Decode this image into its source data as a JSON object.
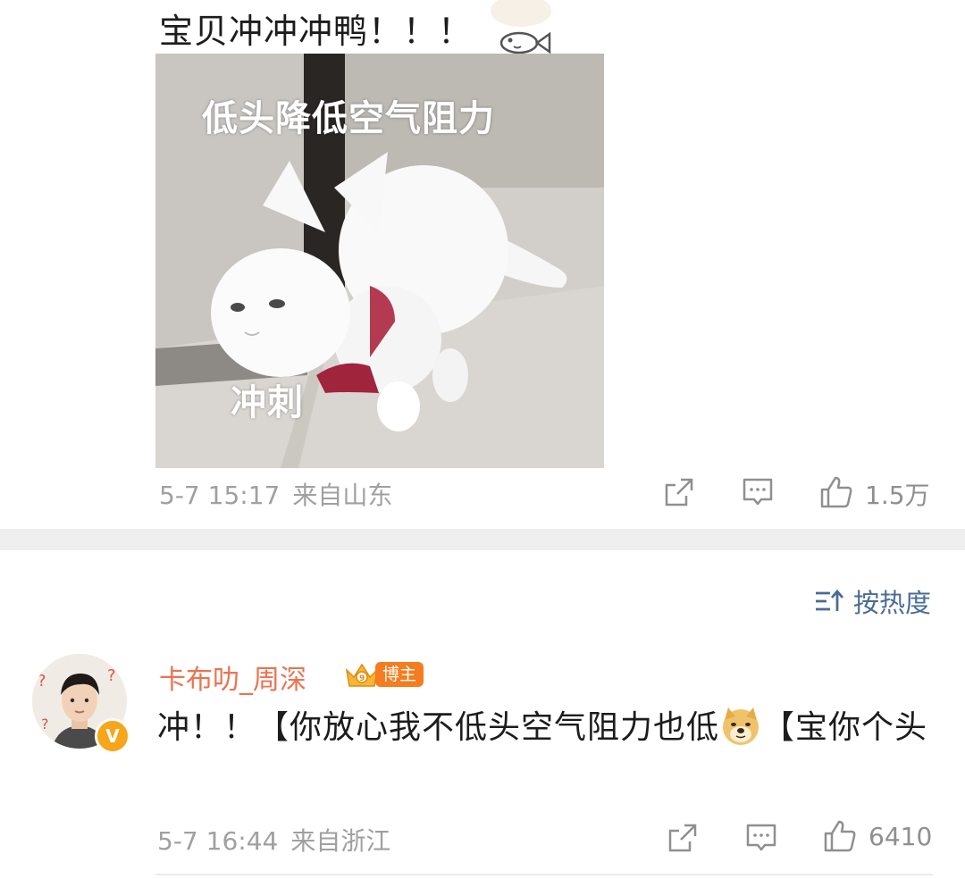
{
  "post": {
    "text": "宝贝冲冲冲鸭！！！",
    "image": {
      "caption_top": "低头降低空气阻力",
      "caption_bottom": "冲刺"
    },
    "date": "5-7 15:17",
    "location": "来自山东",
    "like_count": "1.5万"
  },
  "sort": {
    "label": "按热度"
  },
  "comment": {
    "username": "卡布叻_周深",
    "badge": "博主",
    "text_part1": "冲！！【你放心我不低头空气阻力也低",
    "text_part2": "【宝你个头",
    "date": "5-7 16:44",
    "location": "来自浙江",
    "like_count": "6410"
  },
  "colors": {
    "username": "#eb7350",
    "link_blue": "#4a6b96",
    "meta_gray": "#a0a0a0",
    "divider": "#efefef",
    "badge_orange": "#f57c1f",
    "verified": "#f7a51a"
  },
  "icons": [
    "fish-sticker-icon",
    "share-icon",
    "comment-icon",
    "like-icon",
    "sort-icon",
    "crown-icon",
    "doge-emoji-icon",
    "verified-icon"
  ]
}
